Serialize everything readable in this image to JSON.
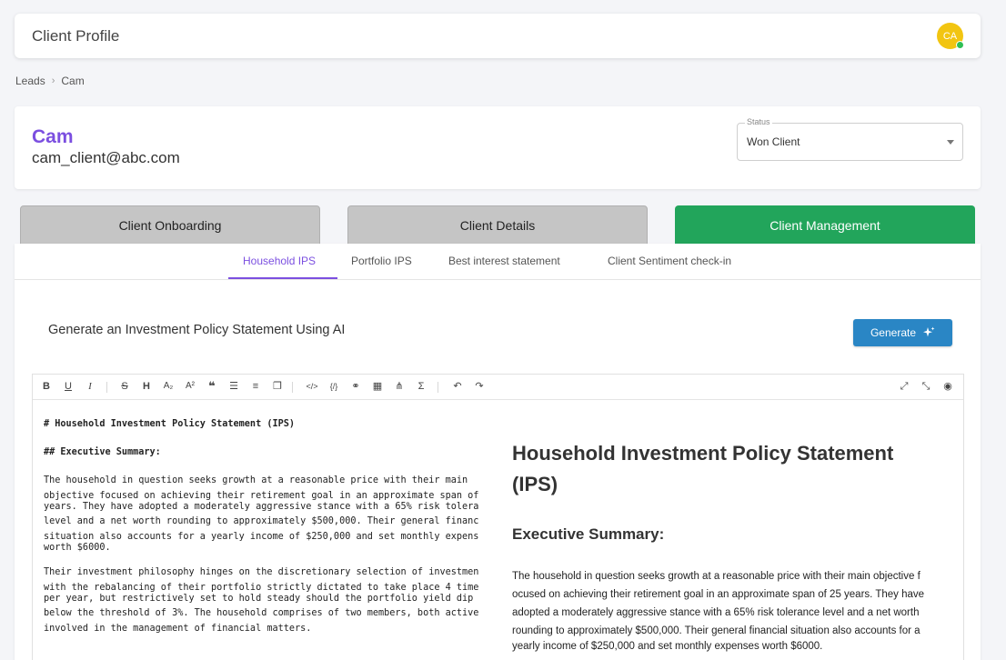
{
  "header": {
    "title": "Client Profile",
    "avatar_initials": "CA"
  },
  "breadcrumb": {
    "items": [
      "Leads",
      "Cam"
    ]
  },
  "client": {
    "name": "Cam",
    "email": "cam_client@abc.com",
    "status_label": "Status",
    "status_value": "Won Client"
  },
  "steps": [
    "Client Onboarding",
    "Client Details",
    "Client Management"
  ],
  "subtabs": [
    "Household IPS",
    "Portfolio IPS",
    "Best interest statement",
    "Client Sentiment check-in"
  ],
  "generate": {
    "label": "Generate an Investment Policy Statement Using AI",
    "button": "Generate"
  },
  "toolbar": {
    "icons": [
      "bold-icon",
      "underline-icon",
      "italic-icon",
      "strikethrough-icon",
      "heading-icon",
      "subscript-icon",
      "superscript-icon",
      "quote-icon",
      "bullet-list-icon",
      "numbered-list-icon",
      "checklist-icon",
      "code-icon",
      "code-block-icon",
      "link-icon",
      "table-icon",
      "mermaid-icon",
      "formula-icon",
      "undo-icon",
      "redo-icon",
      "fullscreen-icon",
      "fit-screen-icon",
      "preview-icon"
    ]
  },
  "markdown": {
    "h1": "# Household Investment Policy Statement (IPS)",
    "h2": "## Executive Summary:",
    "p1_lines": [
      "The household in question seeks growth at a reasonable price with their main",
      "objective focused on achieving their retirement goal in an approximate span of",
      "years. They have adopted a moderately aggressive stance with a 65% risk tolera",
      "level and a net worth rounding to approximately $500,000. Their general financ",
      "situation also accounts for a yearly income of $250,000 and set monthly expens",
      "worth $6000."
    ],
    "p2_lines": [
      "Their investment philosophy hinges on the discretionary selection of investmen",
      "with the rebalancing of their portfolio strictly dictated to take place 4 time",
      "per year, but restrictively set to hold steady should the portfolio yield dip",
      "below the threshold of 3%. The household comprises of two members, both active",
      "involved in the management of financial matters."
    ]
  },
  "preview": {
    "h1": "Household Investment Policy Statement (IPS)",
    "h2": "Executive Summary:",
    "p_lines": [
      "The household in question seeks growth at a reasonable price with their main objective f",
      "ocused on achieving their retirement goal in an approximate span of 25 years. They have",
      "adopted a moderately aggressive stance with a 65% risk tolerance level and a net worth",
      "rounding to approximately $500,000. Their general financial situation also accounts for a",
      "yearly income of $250,000 and set monthly expenses worth $6000."
    ]
  }
}
